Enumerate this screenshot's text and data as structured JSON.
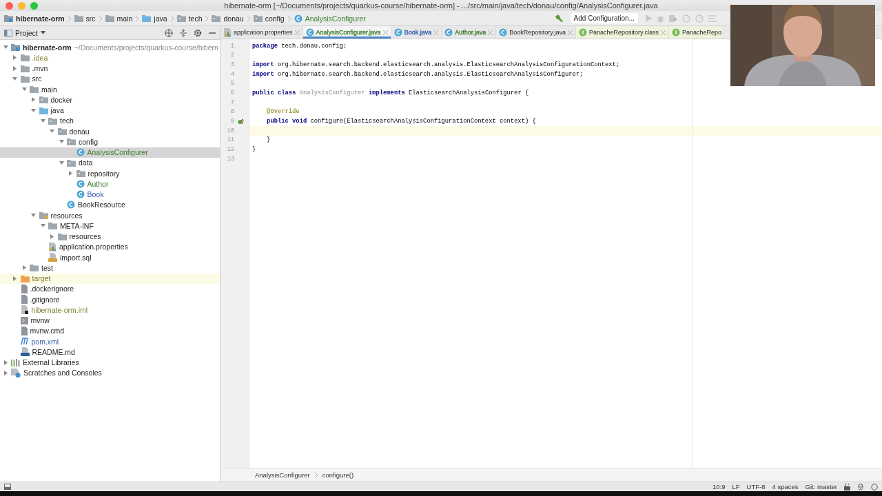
{
  "window": {
    "title": "hibernate-orm [~/Documents/projects/quarkus-course/hibernate-orm] - .../src/main/java/tech/donau/config/AnalysisConfigurer.java"
  },
  "navigation_bar": {
    "crumbs": [
      {
        "label": "hibernate-orm",
        "kind": "project"
      },
      {
        "label": "src",
        "kind": "folder"
      },
      {
        "label": "main",
        "kind": "folder"
      },
      {
        "label": "java",
        "kind": "source-folder"
      },
      {
        "label": "tech",
        "kind": "package"
      },
      {
        "label": "donau",
        "kind": "package"
      },
      {
        "label": "config",
        "kind": "package"
      },
      {
        "label": "AnalysisConfigurer",
        "kind": "class",
        "color": "#3b7d2a"
      }
    ],
    "run_configuration": "Add Configuration..."
  },
  "project_panel": {
    "title": "Project"
  },
  "tree": {
    "items": [
      {
        "label": "hibernate-orm",
        "path": "~/Documents/projects/quarkus-course/hibern",
        "kind": "project",
        "selected": false,
        "expanded": true,
        "children": [
          {
            "label": ".idea",
            "kind": "folder",
            "color": "#7d7d2c",
            "selected": false,
            "expanded": false
          },
          {
            "label": ".mvn",
            "kind": "folder",
            "selected": false,
            "expanded": false
          },
          {
            "label": "src",
            "kind": "folder",
            "selected": false,
            "expanded": true,
            "children": [
              {
                "label": "main",
                "kind": "folder",
                "selected": false,
                "expanded": true,
                "children": [
                  {
                    "label": "docker",
                    "kind": "package",
                    "selected": false,
                    "expanded": false
                  },
                  {
                    "label": "java",
                    "kind": "source-folder",
                    "selected": false,
                    "expanded": true,
                    "children": [
                      {
                        "label": "tech",
                        "kind": "package",
                        "selected": false,
                        "expanded": true,
                        "children": [
                          {
                            "label": "donau",
                            "kind": "package",
                            "selected": false,
                            "expanded": true,
                            "children": [
                              {
                                "label": "config",
                                "kind": "package",
                                "selected": false,
                                "expanded": true,
                                "children": [
                                  {
                                    "label": "AnalysisConfigurer",
                                    "kind": "class",
                                    "color": "#3b7d2a",
                                    "selected": true
                                  }
                                ]
                              },
                              {
                                "label": "data",
                                "kind": "package",
                                "selected": false,
                                "expanded": true,
                                "children": [
                                  {
                                    "label": "repository",
                                    "kind": "package",
                                    "selected": false,
                                    "expanded": false
                                  },
                                  {
                                    "label": "Author",
                                    "kind": "class",
                                    "color": "#3b7d2a",
                                    "selected": false
                                  },
                                  {
                                    "label": "Book",
                                    "kind": "class",
                                    "color": "#2d5bb0",
                                    "selected": false
                                  }
                                ]
                              },
                              {
                                "label": "BookResource",
                                "kind": "class",
                                "selected": false
                              }
                            ]
                          }
                        ]
                      }
                    ]
                  },
                  {
                    "label": "resources",
                    "kind": "resources-folder",
                    "selected": false,
                    "expanded": true,
                    "children": [
                      {
                        "label": "META-INF",
                        "kind": "folder",
                        "selected": false,
                        "expanded": true,
                        "children": [
                          {
                            "label": "resources",
                            "kind": "folder",
                            "selected": false,
                            "expanded": false
                          }
                        ]
                      },
                      {
                        "label": "application.properties",
                        "kind": "properties",
                        "selected": false
                      },
                      {
                        "label": "import.sql",
                        "kind": "sql",
                        "selected": false
                      }
                    ]
                  }
                ]
              },
              {
                "label": "test",
                "kind": "folder",
                "selected": false,
                "expanded": false
              }
            ]
          },
          {
            "label": "target",
            "kind": "excluded-folder",
            "color": "#7d7d2c",
            "selected": false,
            "expanded": false
          },
          {
            "label": ".dockerignore",
            "kind": "file",
            "selected": false
          },
          {
            "label": ".gitignore",
            "kind": "file",
            "selected": false
          },
          {
            "label": "hibernate-orm.iml",
            "kind": "module-file",
            "color": "#7d7d2c",
            "selected": false
          },
          {
            "label": "mvnw",
            "kind": "script",
            "selected": false
          },
          {
            "label": "mvnw.cmd",
            "kind": "file",
            "selected": false
          },
          {
            "label": "pom.xml",
            "kind": "maven",
            "color": "#2d5bb0",
            "selected": false
          },
          {
            "label": "README.md",
            "kind": "markdown",
            "selected": false
          }
        ]
      },
      {
        "label": "External Libraries",
        "kind": "libraries",
        "selected": false,
        "expanded": false
      },
      {
        "label": "Scratches and Consoles",
        "kind": "scratches",
        "selected": false,
        "expanded": false
      }
    ]
  },
  "tabs": [
    {
      "label": "application.properties",
      "kind": "properties",
      "selected": false,
      "closable": true
    },
    {
      "label": "AnalysisConfigurer.java",
      "kind": "class",
      "color": "#3b7d2a",
      "selected": true,
      "closable": true
    },
    {
      "label": "Book.java",
      "kind": "class",
      "color": "#2d5bb0",
      "selected": false,
      "closable": true
    },
    {
      "label": "Author.java",
      "kind": "class",
      "color": "#3b7d2a",
      "selected": false,
      "closable": true
    },
    {
      "label": "BookRepository.java",
      "kind": "class",
      "selected": false,
      "closable": true
    },
    {
      "label": "PanacheRepository.class",
      "kind": "interface",
      "selected": false,
      "closable": true
    },
    {
      "label": "PanacheRepo",
      "kind": "interface",
      "selected": false,
      "closable": false
    }
  ],
  "editor": {
    "lines": [
      {
        "number": "1",
        "current": false,
        "tokens": [
          {
            "kind": "keyword",
            "text": "package"
          },
          {
            "kind": "plain",
            "text": " tech.donau.config;"
          }
        ]
      },
      {
        "number": "2",
        "current": false
      },
      {
        "number": "3",
        "current": false,
        "tokens": [
          {
            "kind": "keyword",
            "text": "import"
          },
          {
            "kind": "plain",
            "text": " org.hibernate.search.backend.elasticsearch.analysis.ElasticsearchAnalysisConfigurationContext;"
          }
        ]
      },
      {
        "number": "4",
        "current": false,
        "tokens": [
          {
            "kind": "keyword",
            "text": "import"
          },
          {
            "kind": "plain",
            "text": " org.hibernate.search.backend.elasticsearch.analysis.ElasticsearchAnalysisConfigurer;"
          }
        ]
      },
      {
        "number": "5",
        "current": false
      },
      {
        "number": "6",
        "current": false,
        "tokens": [
          {
            "kind": "keyword",
            "text": "public class"
          },
          {
            "kind": "unused",
            "text": " AnalysisConfigurer"
          },
          {
            "kind": "keyword",
            "text": " implements"
          },
          {
            "kind": "plain",
            "text": " ElasticsearchAnalysisConfigurer {"
          }
        ]
      },
      {
        "number": "7",
        "current": false
      },
      {
        "number": "8",
        "current": false,
        "tokens": [
          {
            "kind": "annotation",
            "text": "    @Override"
          }
        ]
      },
      {
        "number": "9",
        "current": false,
        "kind": "override",
        "tokens": [
          {
            "kind": "keyword",
            "text": "    public void"
          },
          {
            "kind": "plain",
            "text": " configure(ElasticsearchAnalysisConfigurationContext context) {"
          }
        ]
      },
      {
        "number": "10",
        "current": true
      },
      {
        "number": "11",
        "current": false,
        "tokens": [
          {
            "kind": "plain",
            "text": "    }"
          }
        ]
      },
      {
        "number": "12",
        "current": false,
        "tokens": [
          {
            "kind": "plain",
            "text": "}"
          }
        ]
      },
      {
        "number": "13",
        "current": false
      }
    ],
    "breadcrumbs": [
      "AnalysisConfigurer",
      "configure()"
    ]
  },
  "status_bar": {
    "items": [
      "10:9",
      "LF",
      "UTF-8",
      "4 spaces",
      "Git: master"
    ]
  }
}
